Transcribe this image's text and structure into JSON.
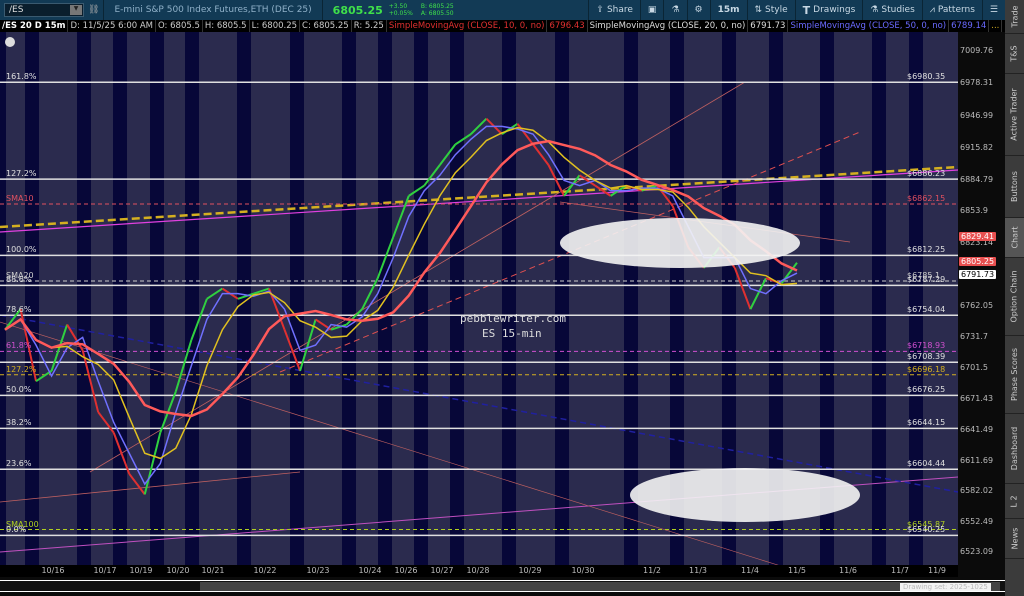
{
  "toolbar": {
    "symbol": "/ES",
    "description": "E-mini S&P 500 Index Futures,ETH (DEC 25)",
    "last": "6805.25",
    "change": "+3.50",
    "change_pct": "+0.05%",
    "bid": "B: 6805.25",
    "ask": "A: 6805.50",
    "share": "Share",
    "timeframe": "15m",
    "style": "Style",
    "drawings": "Drawings",
    "studies": "Studies",
    "patterns": "Patterns"
  },
  "info": {
    "title": "/ES 20 D 15m",
    "date": "D: 11/5/25 6:00 AM",
    "open": "O: 6805.5",
    "high": "H: 6805.5",
    "low": "L: 6800.25",
    "close": "C: 6805.25",
    "range": "R: 5.25",
    "sma10": "SimpleMovingAvg (CLOSE, 10, 0, no)",
    "sma10_val": "6796.43",
    "sma20": "SimpleMovingAvg (CLOSE, 20, 0, no)",
    "sma20_val": "6791.73",
    "sma50": "SimpleMovingAvg (CLOSE, 50, 0, no)",
    "sma50_val": "6789.14",
    "more": "..."
  },
  "price_axis": [
    "7009.76",
    "6978.31",
    "6946.99",
    "6915.82",
    "6884.79",
    "6853.9",
    "6823.14",
    "6762.05",
    "6731.7",
    "6701.5",
    "6671.43",
    "6641.49",
    "6611.69",
    "6582.02",
    "6552.49",
    "6523.09"
  ],
  "price_tags": [
    {
      "value": "6829.41",
      "color": "#e85050"
    },
    {
      "value": "6805.25",
      "color": "#e85050"
    },
    {
      "value": "6791.73",
      "color": "#ffffff"
    }
  ],
  "levels": [
    {
      "label": "161.8%",
      "price": 6980.35,
      "text": "$6980.35",
      "color": "#e0e0e0"
    },
    {
      "label": "127.2%",
      "price": 6886.23,
      "text": "$6886.23",
      "color": "#e0e0e0"
    },
    {
      "label": "SMA10",
      "price": 6862.15,
      "text": "$6862.15",
      "color": "#e05060"
    },
    {
      "label": "100.0%",
      "price": 6812.25,
      "text": "$6812.25",
      "color": "#e0e0e0"
    },
    {
      "label": "SMA20",
      "price": 6787.29,
      "text": "$6785.1",
      "color": "#cccccc"
    },
    {
      "label": "88.6%",
      "price": 6783.0,
      "text": "$6787.29",
      "color": "#e0e0e0"
    },
    {
      "label": "78.6%",
      "price": 6754.04,
      "text": "$6754.04",
      "color": "#e0e0e0"
    },
    {
      "label": "61.8%",
      "price": 6718.93,
      "text": "$6718.93",
      "color": "#d050d0"
    },
    {
      "label": "",
      "price": 6708.39,
      "text": "$6708.39",
      "color": "#e0e0e0"
    },
    {
      "label": "127.2%",
      "price": 6696.18,
      "text": "$6696.18",
      "color": "#d4b020"
    },
    {
      "label": "50.0%",
      "price": 6676.25,
      "text": "$6676.25",
      "color": "#e0e0e0"
    },
    {
      "label": "38.2%",
      "price": 6644.15,
      "text": "$6644.15",
      "color": "#e0e0e0"
    },
    {
      "label": "23.6%",
      "price": 6604.44,
      "text": "$6604.44",
      "color": "#e0e0e0"
    },
    {
      "label": "SMA100",
      "price": 6545.87,
      "text": "$6545.87",
      "color": "#b0d020"
    },
    {
      "label": "0.0%",
      "price": 6540.25,
      "text": "$6540.25",
      "color": "#e0e0e0"
    }
  ],
  "dates": [
    "10/16",
    "10/17",
    "10/19",
    "10/20",
    "10/21",
    "10/22",
    "10/23",
    "10/24",
    "10/26",
    "10/27",
    "10/28",
    "10/29",
    "10/30",
    "11/2",
    "11/3",
    "11/4",
    "11/5",
    "11/6",
    "11/7",
    "11/9"
  ],
  "price_path": [
    6740,
    6760,
    6690,
    6700,
    6745,
    6720,
    6660,
    6640,
    6600,
    6580,
    6640,
    6680,
    6730,
    6770,
    6780,
    6770,
    6775,
    6780,
    6740,
    6700,
    6750,
    6740,
    6745,
    6760,
    6790,
    6830,
    6870,
    6880,
    6900,
    6920,
    6930,
    6945,
    6930,
    6940,
    6920,
    6900,
    6870,
    6890,
    6880,
    6870,
    6880,
    6875,
    6880,
    6860,
    6820,
    6800,
    6820,
    6800,
    6760,
    6790,
    6785,
    6805
  ],
  "watermark": {
    "line1": "pebblewriter.com",
    "line2": "ES 15-min"
  },
  "drawing_set": "Drawing set: 2025-1025",
  "tabs": [
    "Trade",
    "T&S",
    "Active Trader",
    "Buttons",
    "Chart",
    "Option Chain",
    "Phase Scores",
    "Dashboard",
    "L 2",
    "News"
  ]
}
